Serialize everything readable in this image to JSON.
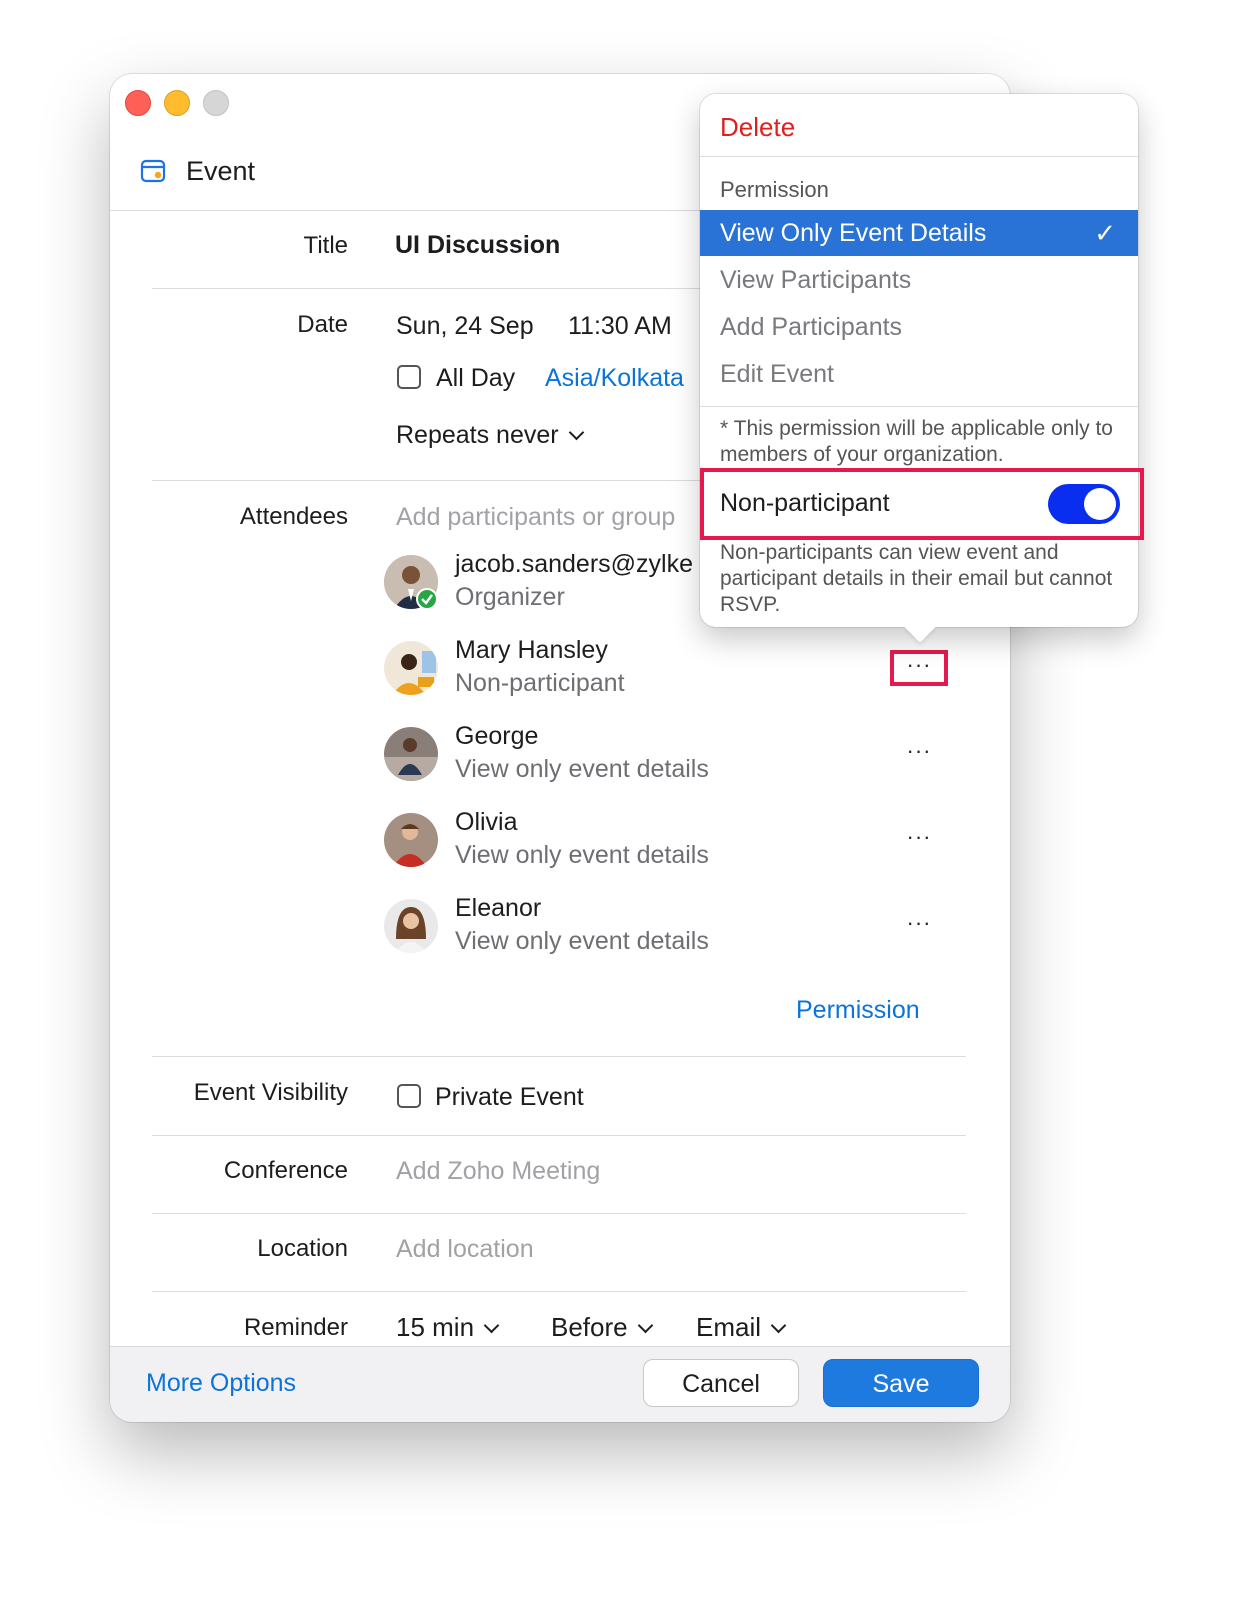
{
  "window": {
    "title": "Event"
  },
  "form": {
    "title_label": "Title",
    "title_value": "UI Discussion",
    "date_label": "Date",
    "date_value": "Sun, 24 Sep",
    "time_value": "11:30 AM",
    "allday_label": "All Day",
    "timezone": "Asia/Kolkata",
    "repeat_label": "Repeats never",
    "attendees_label": "Attendees",
    "attendees_placeholder": "Add participants or group",
    "permission_link": "Permission",
    "visibility_label": "Event Visibility",
    "private_label": "Private Event",
    "conference_label": "Conference",
    "conference_placeholder": "Add Zoho Meeting",
    "location_label": "Location",
    "location_placeholder": "Add location",
    "reminder_label": "Reminder",
    "reminder_time": "15 min",
    "reminder_when": "Before",
    "reminder_type": "Email"
  },
  "attendees": [
    {
      "name": "jacob.sanders@zylke",
      "role": "Organizer"
    },
    {
      "name": "Mary Hansley",
      "role": "Non-participant"
    },
    {
      "name": "George",
      "role": "View only event details"
    },
    {
      "name": "Olivia",
      "role": "View only event details"
    },
    {
      "name": "Eleanor",
      "role": "View only event details"
    }
  ],
  "more_glyph": "···",
  "footer": {
    "more_options": "More Options",
    "cancel": "Cancel",
    "save": "Save"
  },
  "popover": {
    "delete": "Delete",
    "permission_heading": "Permission",
    "options": [
      "View Only Event Details",
      "View Participants",
      "Add Participants",
      "Edit Event"
    ],
    "selected_index": 0,
    "check": "✓",
    "note": "* This permission will be applicable only to members of your organization.",
    "non_participant_label": "Non-participant",
    "non_participant_on": true,
    "non_participant_desc": "Non-participants can view event and participant details in their email but cannot RSVP."
  },
  "colors": {
    "accent": "#0a74da",
    "delete": "#e0201e",
    "selected": "#2a73d6",
    "toggle": "#0a2ef0",
    "highlight": "#e5194e",
    "save": "#1f7ae0"
  }
}
